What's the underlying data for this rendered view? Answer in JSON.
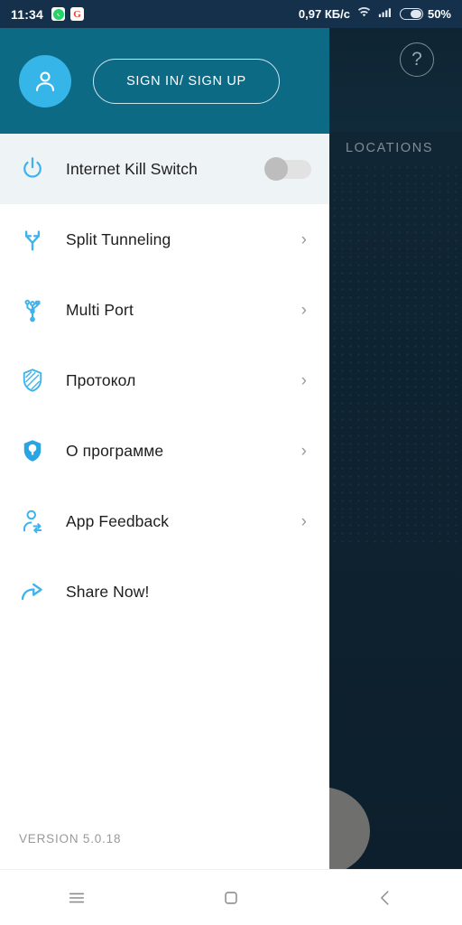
{
  "statusbar": {
    "clock": "11:34",
    "app_icons": [
      {
        "name": "whatsapp-icon",
        "label": ""
      },
      {
        "name": "google-icon",
        "label": "G"
      }
    ],
    "network_speed": "0,97 КБ/c",
    "wifi_icon": "wifi-icon",
    "signal_icon": "cellular-signal-icon",
    "battery_percent": "50%"
  },
  "background_app": {
    "help_icon_label": "?",
    "locations_label": "LOCATIONS"
  },
  "drawer": {
    "avatar_icon": "user-avatar-icon",
    "signin_label": "SIGN IN/ SIGN UP",
    "version": "VERSION 5.0.18",
    "items": [
      {
        "icon": "power-icon",
        "label": "Internet Kill Switch",
        "control": "toggle",
        "toggle_on": false,
        "highlighted": true
      },
      {
        "icon": "split-arrows-icon",
        "label": "Split Tunneling",
        "control": "chevron",
        "chevron": "›",
        "highlighted": false
      },
      {
        "icon": "usb-port-icon",
        "label": "Multi Port",
        "control": "chevron",
        "chevron": "›",
        "highlighted": false
      },
      {
        "icon": "striped-shield-icon",
        "label": "Протокол",
        "control": "chevron",
        "chevron": "›",
        "highlighted": false
      },
      {
        "icon": "shield-icon",
        "label": "О программе",
        "control": "chevron",
        "chevron": "›",
        "highlighted": false
      },
      {
        "icon": "feedback-person-icon",
        "label": "App Feedback",
        "control": "chevron",
        "chevron": "›",
        "highlighted": false
      },
      {
        "icon": "share-arrow-icon",
        "label": "Share Now!",
        "control": "none",
        "chevron": "",
        "highlighted": false
      }
    ]
  },
  "navbar": {
    "recents_icon": "menu-icon",
    "home_icon": "square-home-icon",
    "back_icon": "back-chevron-icon"
  },
  "colors": {
    "header_teal": "#0d6a85",
    "accent_blue": "#36b5e8",
    "icon_blue": "#3fb3ec",
    "statusbar": "#14304a",
    "row_highlight": "#eef3f6",
    "background_navy": "#0e2230"
  }
}
